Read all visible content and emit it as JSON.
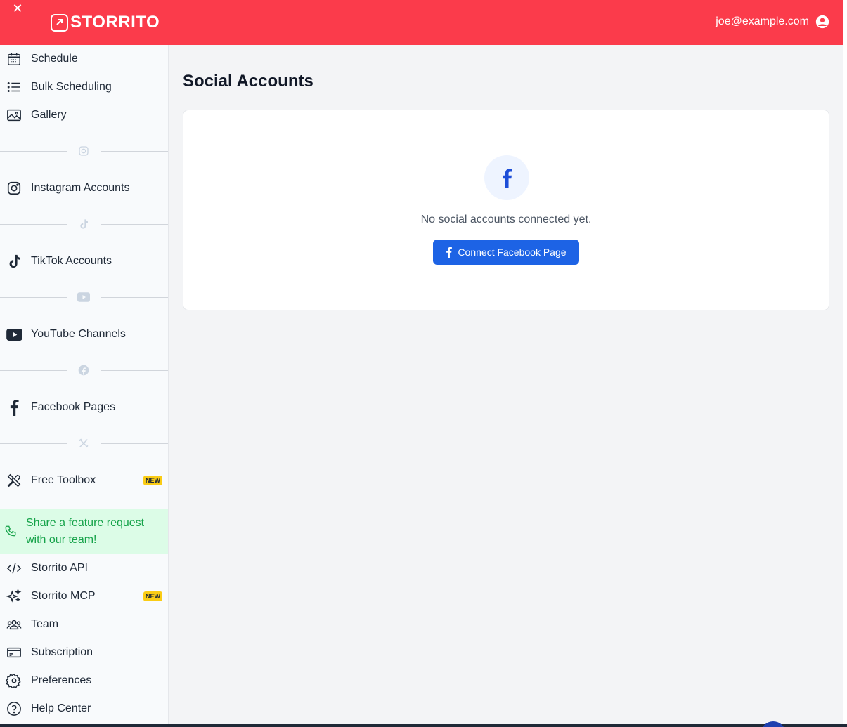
{
  "header": {
    "close_glyph": "✕",
    "brand": "STORRITO",
    "user_email": "joe@example.com",
    "accent_color": "#fb3b4b"
  },
  "sidebar": {
    "top_items": [
      {
        "label": "Schedule",
        "icon": "calendar-icon"
      },
      {
        "label": "Bulk Scheduling",
        "icon": "list-icon"
      },
      {
        "label": "Gallery",
        "icon": "image-icon"
      }
    ],
    "sections": [
      {
        "divider_icon": "instagram-icon",
        "label": "Instagram Accounts",
        "icon": "instagram-icon"
      },
      {
        "divider_icon": "tiktok-icon",
        "label": "TikTok Accounts",
        "icon": "tiktok-icon"
      },
      {
        "divider_icon": "youtube-icon",
        "label": "YouTube Channels",
        "icon": "youtube-icon"
      },
      {
        "divider_icon": "facebook-icon",
        "label": "Facebook Pages",
        "icon": "facebook-icon"
      },
      {
        "divider_icon": "tools-icon",
        "label": "Free Toolbox",
        "icon": "tools-icon",
        "badge": "NEW"
      }
    ],
    "feature_request": "Share a feature request with our team!",
    "bottom_items": [
      {
        "label": "Storrito API",
        "icon": "code-icon"
      },
      {
        "label": "Storrito MCP",
        "icon": "sparkles-icon",
        "badge": "NEW"
      },
      {
        "label": "Team",
        "icon": "team-icon"
      },
      {
        "label": "Subscription",
        "icon": "credit-card-icon"
      },
      {
        "label": "Preferences",
        "icon": "gear-icon"
      },
      {
        "label": "Help Center",
        "icon": "help-icon"
      }
    ]
  },
  "main": {
    "title": "Social Accounts",
    "empty_message": "No social accounts connected yet.",
    "connect_button": "Connect Facebook Page",
    "button_color": "#1d63e5"
  }
}
